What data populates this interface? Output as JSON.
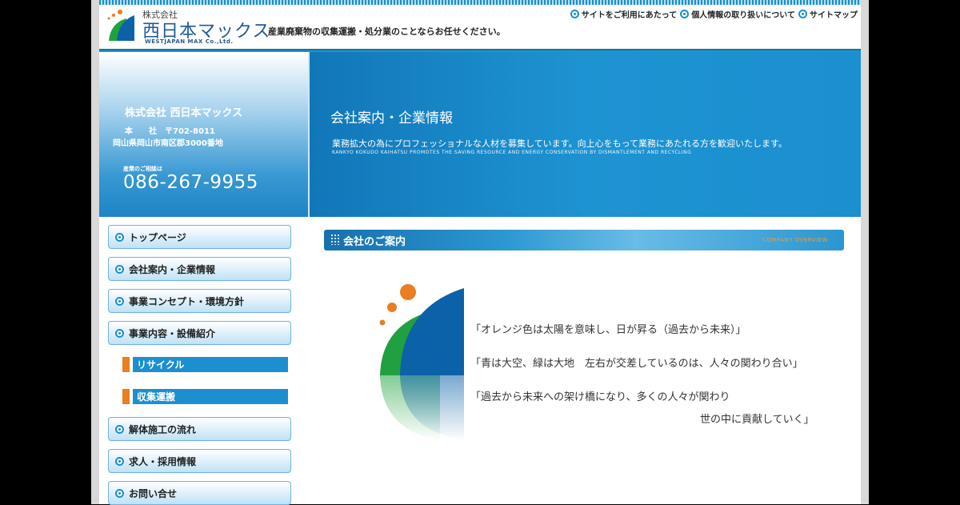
{
  "header": {
    "kabushiki": "株式会社",
    "company_name": "西日本マックス",
    "company_en": "WESTJAPAN MAX Co.,Ltd.",
    "tagline": "産業廃棄物の収集運搬・処分業のことならお任せください。",
    "links": [
      "サイトをご利用にあたって",
      "個人情報の取り扱いについて",
      "サイトマップ"
    ]
  },
  "contact": {
    "company": "株式会社 西日本マックス",
    "addr1": "本　　社　〒702-8011",
    "addr2": "岡山県岡山市南区郡3000番地",
    "tel_label": "産業のご相談は",
    "tel": "086-267-9955"
  },
  "hero": {
    "title": "会社案内・企業情報",
    "subtitle": "業務拡大の為にプロフェッショナルな人材を募集しています。向上心をもって業務にあたれる方を歓迎いたします。",
    "english": "KANKYO KOKUDO KAIHATSU PROMOTES THE SAVING RESOURCE AND ENERGY CONSERVATION BY DISMANTLEMENT AND RECYCLING"
  },
  "nav": {
    "items": [
      "トップページ",
      "会社案内・企業情報",
      "事業コンセプト・環境方針",
      "事業内容・設備紹介"
    ],
    "sub_items": [
      "リサイクル",
      "収集運搬"
    ],
    "items2": [
      "解体施工の流れ",
      "求人・採用情報",
      "お問い合せ"
    ]
  },
  "section": {
    "title": "会社のご案内",
    "english": "COMPANY OVERVIEW",
    "quotes": [
      "「オレンジ色は太陽を意味し、日が昇る（過去から未来）」",
      "「青は大空、緑は大地　左右が交差しているのは、人々の関わり合い」",
      "「過去から未来への架け橋になり、多くの人々が関わり",
      "世の中に貢献していく」"
    ]
  },
  "colors": {
    "primary_blue": "#1b8fcf",
    "accent_orange": "#ea7e20",
    "logo_green": "#20a040",
    "logo_blue": "#0b62a8"
  }
}
